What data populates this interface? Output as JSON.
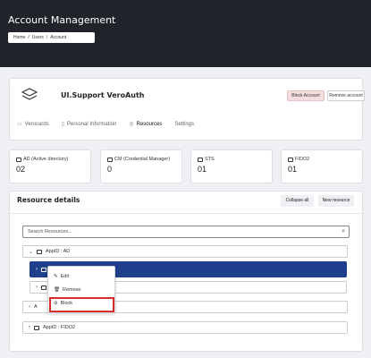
{
  "header": {
    "title": "Account Management",
    "breadcrumb": [
      "Home",
      "/",
      "Users",
      "/",
      "Account"
    ]
  },
  "profile": {
    "name": "UI.Support VeroAuth",
    "block_label": "Block Account",
    "remove_label": "Remove account",
    "tabs": [
      {
        "label": "Verocards",
        "icon": "card-icon",
        "active": false
      },
      {
        "label": "Personal Information",
        "icon": "document-icon",
        "active": false
      },
      {
        "label": "Resources",
        "icon": "eye-icon",
        "active": true
      },
      {
        "label": "Settings",
        "icon": "",
        "active": false
      }
    ]
  },
  "stats": [
    {
      "label": "AD (Active directory)",
      "value": "02"
    },
    {
      "label": "CM (Credential Manager)",
      "value": "0"
    },
    {
      "label": "STS",
      "value": "01"
    },
    {
      "label": "FIDO2",
      "value": "01"
    }
  ],
  "resources": {
    "title": "Resource details",
    "collapse_label": "Collapse all",
    "new_label": "New resource",
    "search_placeholder": "Search Resources...",
    "tree": {
      "group1": "AppID : AD",
      "group3_partial": "A",
      "group4": "AppID : FIDO2"
    }
  },
  "context_menu": {
    "edit": "Edit",
    "remove": "Remove",
    "block": "Block"
  },
  "colors": {
    "header_bg": "#202329",
    "selected_row": "#1f3f8c",
    "highlight": "#d62c2c"
  }
}
